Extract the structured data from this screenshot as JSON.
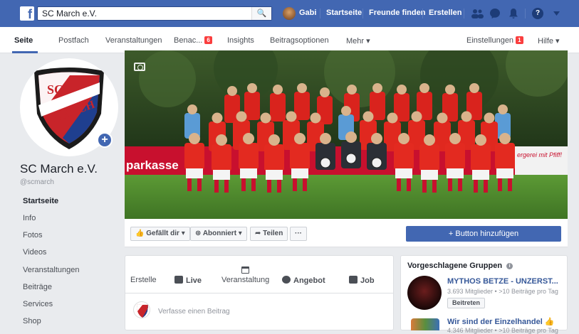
{
  "topbar": {
    "logo": "f",
    "search_value": "SC March e.V.",
    "user_name": "Gabi",
    "nav": [
      "Startseite",
      "Freunde finden",
      "Erstellen"
    ],
    "icons": [
      "friends-icon",
      "messenger-icon",
      "notifications-icon",
      "help-icon",
      "chevron-down-icon"
    ]
  },
  "page_nav": {
    "tabs": [
      {
        "label": "Seite",
        "active": true
      },
      {
        "label": "Postfach"
      },
      {
        "label": "Veranstaltungen"
      },
      {
        "label": "Benac...",
        "badge": "6"
      },
      {
        "label": "Insights"
      },
      {
        "label": "Beitragsoptionen"
      },
      {
        "label": "Mehr ▾"
      }
    ],
    "settings": {
      "label": "Einstellungen",
      "badge": "1"
    },
    "help": "Hilfe ▾"
  },
  "profile": {
    "name": "SC March e.V.",
    "handle": "@scmarch",
    "logo_line1": "SC",
    "logo_line2": "MARCH"
  },
  "sidebar": {
    "items": [
      "Startseite",
      "Info",
      "Fotos",
      "Videos",
      "Veranstaltungen",
      "Beiträge",
      "Services",
      "Shop"
    ]
  },
  "cover": {
    "banner_left": "parkasse",
    "banner_right": "ergerei mit Pfiff!"
  },
  "actions": {
    "like": "Gefällt dir ▾",
    "follow": "Abonniert ▾",
    "share": "Teilen",
    "more": "···",
    "primary": "+ Button hinzufügen"
  },
  "composer": {
    "create_label": "Erstelle",
    "items": [
      "Live",
      "Veranstaltung",
      "Angebot",
      "Job"
    ],
    "placeholder": "Verfasse einen Beitrag"
  },
  "groups": {
    "title": "Vorgeschlagene Gruppen",
    "list": [
      {
        "name": "MYTHOS BETZE - UNZERST...",
        "meta": "3.693 Mitglieder • >10 Beiträge pro Tag",
        "join": "Beitreten"
      },
      {
        "name": "Wir sind der Einzelhandel 👍",
        "meta": "4.346 Mitglieder • >10 Beiträge pro Tag"
      }
    ]
  },
  "colors": {
    "fb_blue": "#4267b2",
    "link_blue": "#365899",
    "badge_red": "#fa3e3e",
    "jersey_red": "#d9231d",
    "pitch_green": "#4f8a2d"
  }
}
